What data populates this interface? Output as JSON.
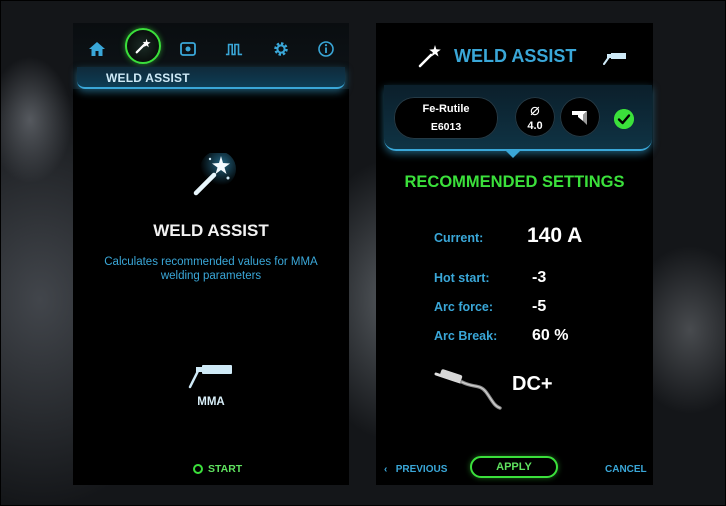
{
  "left_panel": {
    "nav_icons": [
      "home-icon",
      "weld-assist-icon",
      "memory-icon",
      "pulse-icon",
      "settings-icon",
      "info-icon"
    ],
    "active_tab_label": "WELD ASSIST",
    "title": "WELD ASSIST",
    "description": "Calculates recommended values for MMA welding parameters",
    "process_label": "MMA",
    "start_label": "START"
  },
  "right_panel": {
    "title": "WELD ASSIST",
    "electrode": {
      "name": "Fe-Rutile",
      "code": "E6013"
    },
    "diameter": {
      "symbol": "⌀",
      "value": "4.0"
    },
    "recommended_title": "RECOMMENDED SETTINGS",
    "params": {
      "current_label": "Current:",
      "current_value": "140 A",
      "hot_start_label": "Hot start:",
      "hot_start_value": "-3",
      "arc_force_label": "Arc force:",
      "arc_force_value": "-5",
      "arc_break_label": "Arc Break:",
      "arc_break_value": "60 %"
    },
    "polarity": "DC+",
    "footer": {
      "previous": "PREVIOUS",
      "previous_chevron": "‹",
      "apply": "APPLY",
      "cancel": "CANCEL"
    }
  },
  "colors": {
    "accent_blue": "#3aa7d8",
    "accent_green": "#3be03b",
    "panel_bg": "#000000"
  }
}
